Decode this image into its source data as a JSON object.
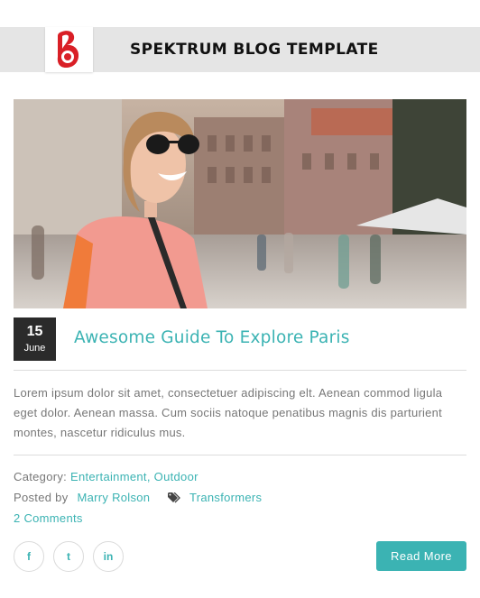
{
  "header": {
    "title": "SPEKTRUM BLOG TEMPLATE",
    "logo_icon": "spektrum-logo-icon",
    "brand_color": "#d91f26"
  },
  "post": {
    "date_day": "15",
    "date_month": "June",
    "title": "Awesome Guide To Explore Paris",
    "excerpt": "Lorem ipsum dolor sit amet, consectetuer adipiscing elt. Aenean commod ligula eget dolor. Aenean massa. Cum sociis natoque penatibus magnis dis parturient montes, nascetur ridiculus mus.",
    "category_label": "Category:",
    "categories": [
      "Entertainment,",
      "Outdoor"
    ],
    "posted_by_label": "Posted by",
    "author": "Marry Rolson",
    "tag_icon": "tag-icon",
    "tag": "Transformers",
    "comments": "2 Comments",
    "read_more": "Read More"
  },
  "social": [
    {
      "icon": "facebook-icon",
      "glyph": "f"
    },
    {
      "icon": "twitter-icon",
      "glyph": "t"
    },
    {
      "icon": "linkedin-icon",
      "glyph": "in"
    }
  ],
  "colors": {
    "accent": "#3bb3b3",
    "date_box": "#2b2b2b",
    "header_bar": "#e5e5e5"
  }
}
